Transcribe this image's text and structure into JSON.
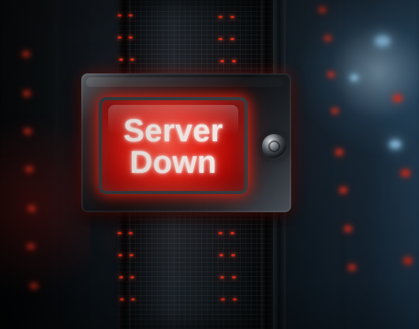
{
  "status_display": {
    "line_1": "Server",
    "line_2": "Down"
  },
  "scene": {
    "primary_color": "#ef2318",
    "accent_color": "#9bd8ff",
    "background_color": "#05080b",
    "icons": {
      "knob": "round-control-knob-icon"
    }
  }
}
